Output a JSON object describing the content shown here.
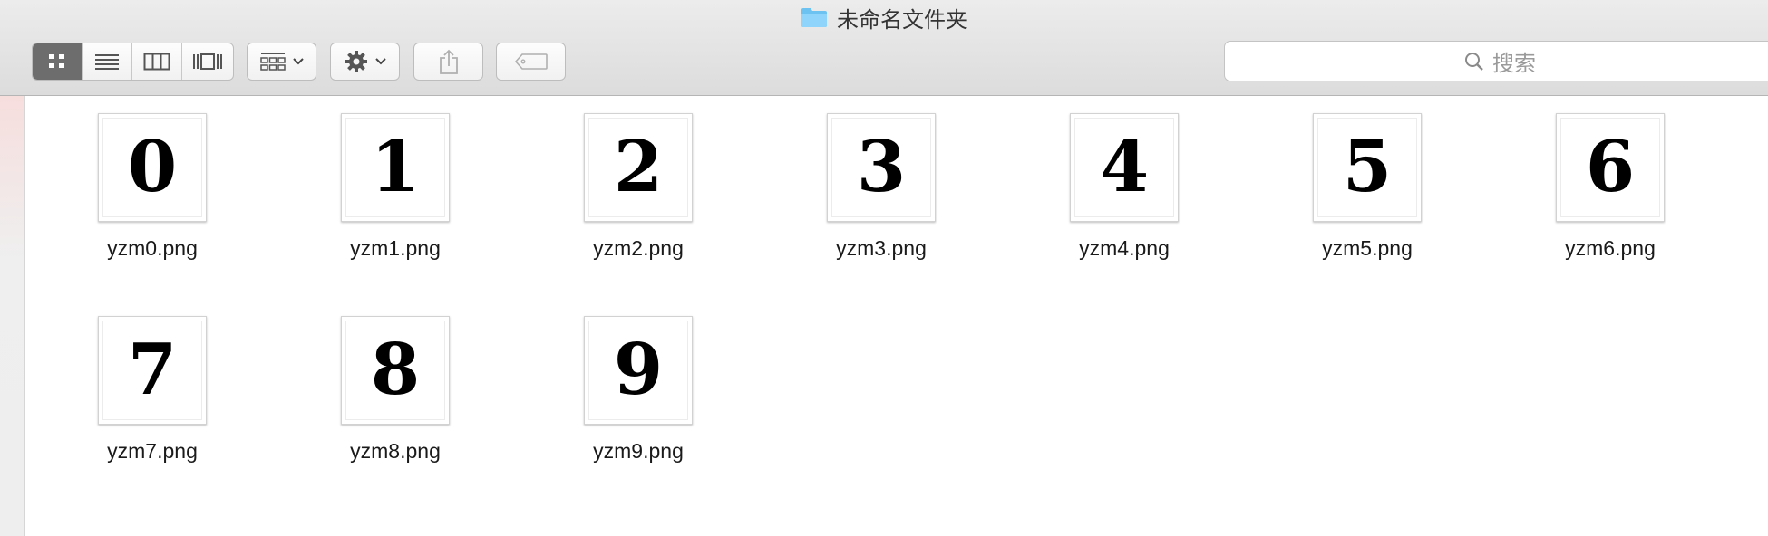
{
  "window": {
    "title": "未命名文件夹",
    "icon": "folder-icon"
  },
  "toolbar": {
    "view_modes": [
      "icon-view",
      "list-view",
      "column-view",
      "cover-flow-view"
    ],
    "active_view": "icon-view",
    "arrange_icon": "arrange-icon",
    "action_icon": "gear-icon",
    "share_icon": "share-icon",
    "tag_icon": "tag-icon"
  },
  "search": {
    "placeholder": "搜索"
  },
  "files": [
    {
      "name": "yzm0.png",
      "digit": "0"
    },
    {
      "name": "yzm1.png",
      "digit": "1"
    },
    {
      "name": "yzm2.png",
      "digit": "2"
    },
    {
      "name": "yzm3.png",
      "digit": "3"
    },
    {
      "name": "yzm4.png",
      "digit": "4"
    },
    {
      "name": "yzm5.png",
      "digit": "5"
    },
    {
      "name": "yzm6.png",
      "digit": "6"
    },
    {
      "name": "yzm7.png",
      "digit": "7"
    },
    {
      "name": "yzm8.png",
      "digit": "8"
    },
    {
      "name": "yzm9.png",
      "digit": "9"
    }
  ]
}
